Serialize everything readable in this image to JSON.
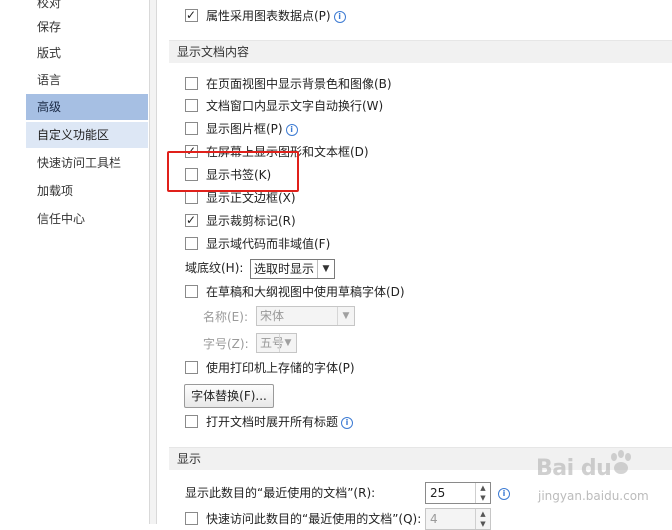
{
  "nav": {
    "items": [
      {
        "label": "校对"
      },
      {
        "label": "保存"
      },
      {
        "label": "版式"
      },
      {
        "label": "语言"
      },
      {
        "label": "高级"
      },
      {
        "label": "自定义功能区"
      },
      {
        "label": "快速访问工具栏"
      },
      {
        "label": "加载项"
      },
      {
        "label": "信任中心"
      }
    ],
    "active_item": "高级"
  },
  "options": {
    "chart_datapoints": {
      "label": "属性采用图表数据点(P)",
      "checked": true
    },
    "section_display_content": "显示文档内容",
    "items": [
      {
        "label": "在页面视图中显示背景色和图像(B)",
        "checked": false
      },
      {
        "label": "文档窗口内显示文字自动换行(W)",
        "checked": false
      },
      {
        "label": "显示图片框(P)",
        "checked": false
      },
      {
        "label": "在屏幕上显示图形和文本框(D)",
        "checked": true
      },
      {
        "label": "显示书签(K)",
        "checked": false
      },
      {
        "label": "显示正文边框(X)",
        "checked": false
      },
      {
        "label": "显示裁剪标记(R)",
        "checked": true
      },
      {
        "label": "显示域代码而非域值(F)",
        "checked": false
      }
    ],
    "field_shading": {
      "label": "域底纹(H):",
      "value": "选取时显示"
    },
    "draft_font": {
      "label": "在草稿和大纲视图中使用草稿字体(D)",
      "checked": false
    },
    "font_name": {
      "label": "名称(E):",
      "value": "宋体"
    },
    "font_size": {
      "label": "字号(Z):",
      "value": "五号"
    },
    "printer_fonts": {
      "label": "使用打印机上存储的字体(P)",
      "checked": false
    },
    "font_substitution_button": "字体替换(F)...",
    "expand_headings": {
      "label": "打开文档时展开所有标题",
      "checked": false
    },
    "section_display": "显示",
    "recent_docs": {
      "label": "显示此数目的“最近使用的文档”(R):",
      "value": "25"
    },
    "quick_access_recent": {
      "label": "快速访问此数目的“最近使用的文档”(Q):",
      "value": "4",
      "checked": false
    }
  },
  "watermark": {
    "brand": "Bai du",
    "url": "jingyan.baidu.com"
  },
  "colors": {
    "active_nav": "#a6bfe3",
    "highlight": "#e0201a",
    "info_icon": "#3d7bd3"
  }
}
